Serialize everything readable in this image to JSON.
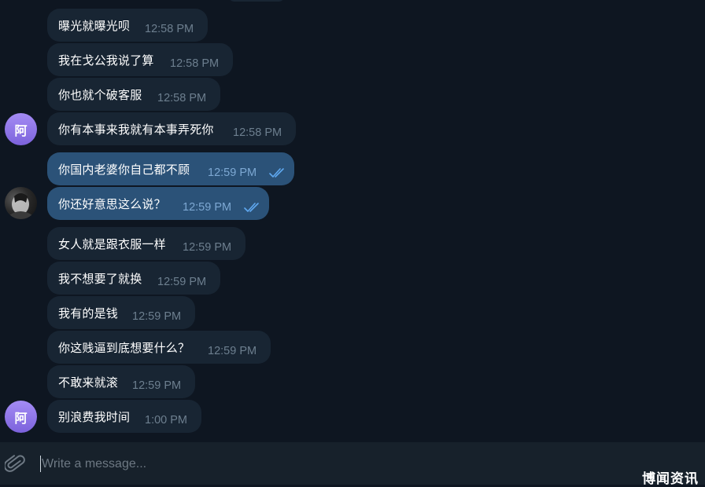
{
  "messages": [
    {
      "text": "曝光就曝光呗",
      "time": "12:58 PM"
    },
    {
      "text": "我在戈公我说了算",
      "time": "12:58 PM"
    },
    {
      "text": "你也就个破客服",
      "time": "12:58 PM"
    },
    {
      "text": "你有本事来我就有本事弄死你",
      "time": "12:58 PM"
    },
    {
      "text": "你国内老婆你自己都不顾",
      "time": "12:59 PM"
    },
    {
      "text": "你还好意思这么说？",
      "time": "12:59 PM"
    },
    {
      "text": "女人就是跟衣服一样",
      "time": "12:59 PM"
    },
    {
      "text": "我不想要了就换",
      "time": "12:59 PM"
    },
    {
      "text": "我有的是钱",
      "time": "12:59 PM"
    },
    {
      "text": "你这贱逼到底想要什么？",
      "time": "12:59 PM"
    },
    {
      "text": "不敢来就滚",
      "time": "12:59 PM"
    },
    {
      "text": "别浪费我时间",
      "time": "1:00 PM"
    }
  ],
  "avatars": {
    "contact_initial": "阿"
  },
  "composer": {
    "placeholder": "Write a message..."
  },
  "watermark": "博闻资讯",
  "colors": {
    "background": "#0e1621",
    "incoming_bubble": "#182533",
    "outgoing_bubble": "#2b5278",
    "read_check": "#5fa8f0",
    "avatar_accent": "#8b72e8"
  },
  "icons": [
    "double-check-icon",
    "paperclip-icon"
  ]
}
